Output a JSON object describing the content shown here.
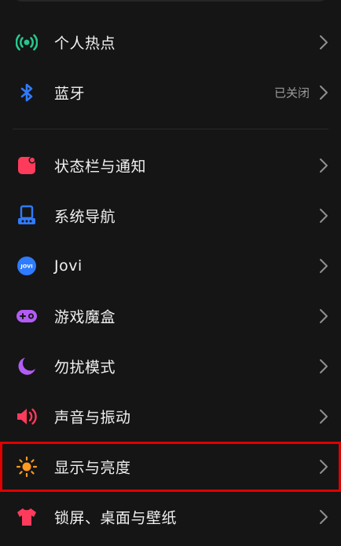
{
  "colors": {
    "background": "#151515",
    "highlight": "#e00000",
    "chevron": "#8f8f8f"
  },
  "group1": [
    {
      "label": "个人热点",
      "icon": "hotspot-icon",
      "color": "#26c78e"
    },
    {
      "label": "蓝牙",
      "icon": "bluetooth-icon",
      "color": "#2f7bff",
      "value": "已关闭"
    }
  ],
  "group2": [
    {
      "label": "状态栏与通知",
      "icon": "status-bar-icon",
      "color": "#ff3b5c"
    },
    {
      "label": "系统导航",
      "icon": "navigation-icon",
      "color": "#2f7bff"
    },
    {
      "label": "Jovi",
      "icon": "jovi-icon",
      "color": "#2f7bff",
      "icon_text": "JOVI"
    },
    {
      "label": "游戏魔盒",
      "icon": "gamepad-icon",
      "color": "#b25cf5"
    },
    {
      "label": "勿扰模式",
      "icon": "moon-icon",
      "color": "#b25cf5"
    },
    {
      "label": "声音与振动",
      "icon": "speaker-icon",
      "color": "#ff3b5c"
    },
    {
      "label": "显示与亮度",
      "icon": "sun-icon",
      "color": "#ff9a1f"
    },
    {
      "label": "锁屏、桌面与壁纸",
      "icon": "tshirt-icon",
      "color": "#ff3b5c"
    }
  ]
}
